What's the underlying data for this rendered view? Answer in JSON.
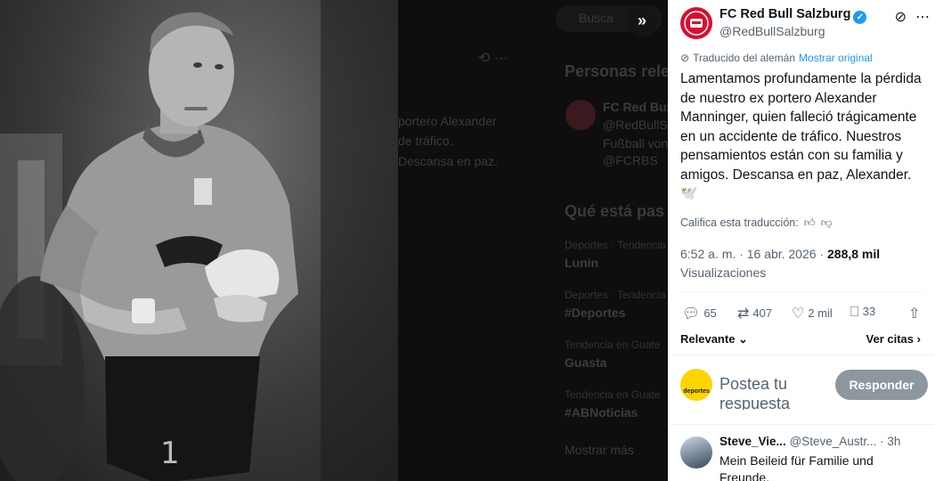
{
  "background": {
    "bleed_header": "Personas relev",
    "account_name": "FC Red Bull",
    "account_handle": "@RedBullS",
    "account_bio": "Fußball von",
    "account_bio2": "@FCRBS",
    "post_fragment_1": "portero Alexander",
    "post_fragment_2": "de tráfico.",
    "post_fragment_3": "Descansa en paz.",
    "trends_header": "Qué está pas",
    "trends": [
      {
        "category": "Deportes · Tendencia",
        "name": "Lunin"
      },
      {
        "category": "Deportes · Tendencia",
        "name": "#Deportes"
      },
      {
        "category": "Tendencia en Guate",
        "name": "Guasta"
      },
      {
        "category": "Tendencia en Guate",
        "name": "#ABNoticias"
      }
    ],
    "show_more": "Mostrar más",
    "search_placeholder": "Busca"
  },
  "post": {
    "author_name": "FC Red Bull Salzburg",
    "author_handle": "@RedBullSalzburg",
    "translated_from": "Traducido del alemán",
    "show_original": "Mostrar original",
    "text": "Lamentamos profundamente la pérdida de nuestro ex portero Alexander Manninger, quien falleció trágicamente en un accidente de tráfico. Nuestros pensamientos están con su familia y amigos. Descansa en paz, Alexander. 🕊️",
    "rate_translation": "Califica esta traducción:",
    "time": "6:52 a. m. · 16 abr. 2026",
    "views_count": "288,8 mil",
    "views_label": "Visualizaciones",
    "replies": "65",
    "reposts": "407",
    "likes": "2 mil",
    "bookmarks": "33",
    "sort_label": "Relevante",
    "quotes_label": "Ver citas"
  },
  "composer": {
    "avatar_text": "deportes",
    "placeholder": "Postea tu respuesta",
    "reply_button": "Responder"
  },
  "reply": {
    "name": "Steve_Vie...",
    "handle": "@Steve_Austr...",
    "time": "· 3h",
    "text": "Mein Beileid für Familie und Freunde."
  },
  "colors": {
    "accent": "#1d9bf0",
    "club_red": "#d8102f",
    "reply_button": "#8d979e"
  }
}
